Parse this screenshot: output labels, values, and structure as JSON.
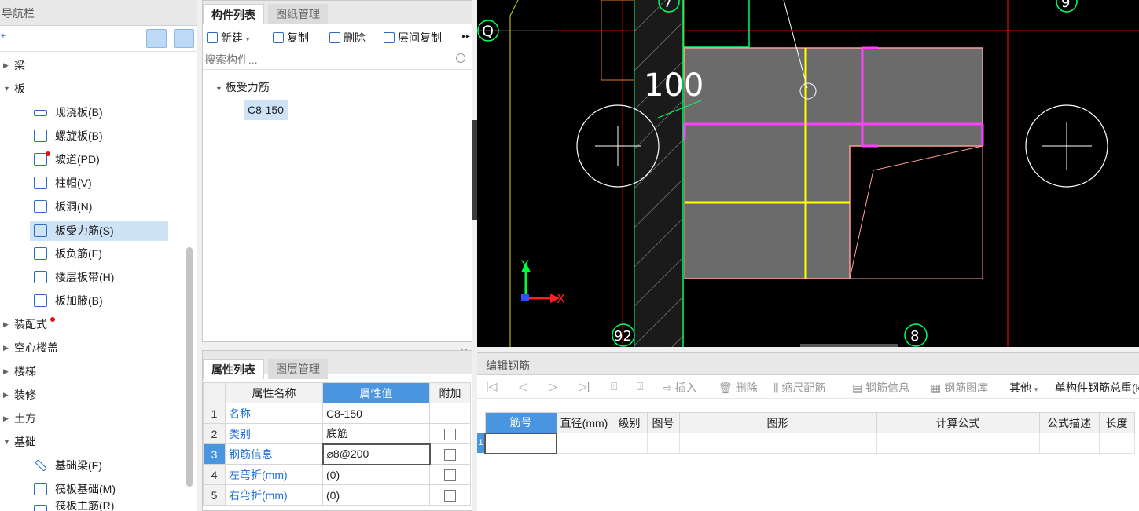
{
  "nav": {
    "title": "导航栏",
    "tree": [
      {
        "label": "梁",
        "expanded": false
      },
      {
        "label": "板",
        "expanded": true
      },
      {
        "label": "现浇板(B)"
      },
      {
        "label": "螺旋板(B)"
      },
      {
        "label": "坡道(PD)"
      },
      {
        "label": "柱帽(V)"
      },
      {
        "label": "板洞(N)"
      },
      {
        "label": "板受力筋(S)",
        "selected": true
      },
      {
        "label": "板负筋(F)"
      },
      {
        "label": "楼层板带(H)"
      },
      {
        "label": "板加腋(B)"
      },
      {
        "label": "装配式",
        "expanded": false
      },
      {
        "label": "空心楼盖",
        "expanded": false
      },
      {
        "label": "楼梯",
        "expanded": false
      },
      {
        "label": "装修",
        "expanded": false
      },
      {
        "label": "土方",
        "expanded": false
      },
      {
        "label": "基础",
        "expanded": true
      },
      {
        "label": "基础梁(F)"
      },
      {
        "label": "筏板基础(M)"
      },
      {
        "label": "筏板主筋(R)"
      }
    ]
  },
  "component_panel": {
    "tabs": [
      "构件列表",
      "图纸管理"
    ],
    "toolbar": {
      "new": "新建",
      "copy": "复制",
      "delete": "删除",
      "floor_copy": "层间复制"
    },
    "search_placeholder": "搜索构件...",
    "tree_root": "板受力筋",
    "selected_item": "C8-150"
  },
  "property_panel": {
    "tabs": [
      "属性列表",
      "图层管理"
    ],
    "headers": {
      "name": "属性名称",
      "value": "属性值",
      "extra": "附加"
    },
    "rows": [
      {
        "num": "1",
        "name": "名称",
        "value": "C8-150",
        "has_checkbox": false
      },
      {
        "num": "2",
        "name": "类别",
        "value": "底筋",
        "has_checkbox": true
      },
      {
        "num": "3",
        "name": "钢筋信息",
        "value": "⌀8@200",
        "has_checkbox": true,
        "editing": true
      },
      {
        "num": "4",
        "name": "左弯折(mm)",
        "value": "(0)",
        "has_checkbox": true
      },
      {
        "num": "5",
        "name": "右弯折(mm)",
        "value": "(0)",
        "has_checkbox": true
      }
    ]
  },
  "cad": {
    "labels": {
      "axis_q": "Q",
      "axis_7": "7",
      "axis_9": "9",
      "axis_92": "92",
      "axis_8": "8",
      "dim_text": "100",
      "y_axis": "Y",
      "x_axis": "X"
    },
    "colors": {
      "background": "#000000",
      "slab": "#6b6b6b",
      "slab_outline": "#ff9c9c",
      "rebar_x": "#ff40ff",
      "rebar_y": "#ffff00",
      "grid_line": "#c00000",
      "wall": "#00ff66"
    }
  },
  "rebar_editor": {
    "title": "编辑钢筋",
    "toolbar": {
      "insert": "插入",
      "delete": "删除",
      "scale": "缩尺配筋",
      "info": "钢筋信息",
      "library": "钢筋图库",
      "other": "其他",
      "total": "单构件钢筋总重(kg):"
    },
    "columns": [
      "筋号",
      "直径(mm)",
      "级别",
      "图号",
      "图形",
      "计算公式",
      "公式描述",
      "长度"
    ],
    "row_num": "1"
  }
}
